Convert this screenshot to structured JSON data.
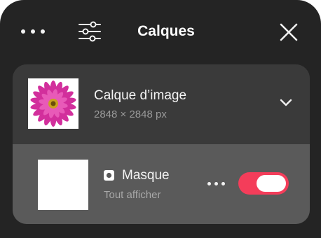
{
  "header": {
    "title": "Calques",
    "left_icon": "more-horizontal-icon",
    "settings_icon": "sliders-icon",
    "close_icon": "close-icon"
  },
  "layers": [
    {
      "name": "Calque d’image",
      "size": "2848 × 2848 px",
      "thumbnail": "pink-flower-image",
      "expand_icon": "chevron-down-icon"
    }
  ],
  "mask": {
    "name": "Masque",
    "subtitle": "Tout afficher",
    "icon": "mask-icon",
    "options_icon": "more-horizontal-icon",
    "enabled": true
  },
  "colors": {
    "panel_bg": "#242424",
    "card_bg": "#3a3a3a",
    "mask_row_bg": "#5a5a5a",
    "toggle_on": "#f43d5a"
  }
}
